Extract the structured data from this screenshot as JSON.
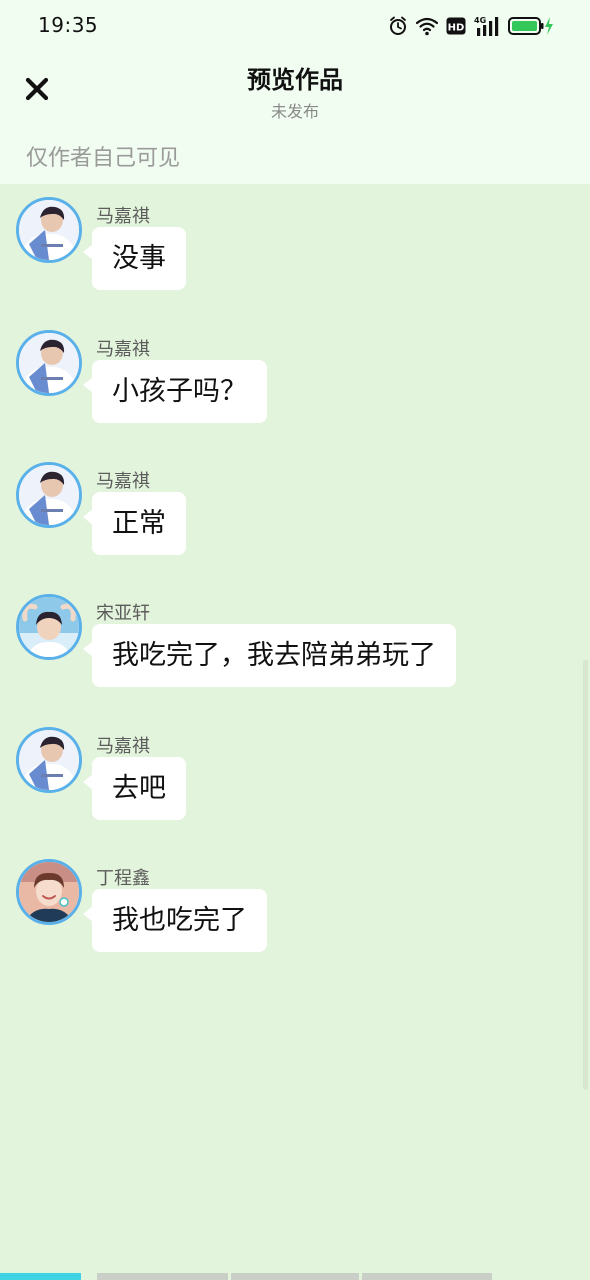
{
  "status_bar": {
    "time": "19:35",
    "network_label": "4G",
    "hd_label": "HD",
    "battery_color": "#34c759"
  },
  "header": {
    "title": "预览作品",
    "subtitle": "未发布",
    "visibility_note": "仅作者自己可见",
    "close_icon": "close-icon"
  },
  "messages": [
    {
      "sender": "马嘉祺",
      "text": "没事",
      "avatar": "avatar-majiaqi"
    },
    {
      "sender": "马嘉祺",
      "text": "小孩子吗？",
      "avatar": "avatar-majiaqi"
    },
    {
      "sender": "马嘉祺",
      "text": "正常",
      "avatar": "avatar-majiaqi"
    },
    {
      "sender": "宋亚轩",
      "text": "我吃完了，我去陪弟弟玩了",
      "avatar": "avatar-songyaxuan"
    },
    {
      "sender": "马嘉祺",
      "text": "去吧",
      "avatar": "avatar-majiaqi"
    },
    {
      "sender": "丁程鑫",
      "text": "我也吃完了",
      "avatar": "avatar-dingchengxin"
    }
  ],
  "colors": {
    "header_bg": "#f1fdf0",
    "chat_bg": "#e3f4dc",
    "bubble_bg": "#ffffff",
    "avatar_ring": "#5ab1ea",
    "progress_active": "#3fd3e3",
    "progress_inactive": "#c9cfc6"
  }
}
